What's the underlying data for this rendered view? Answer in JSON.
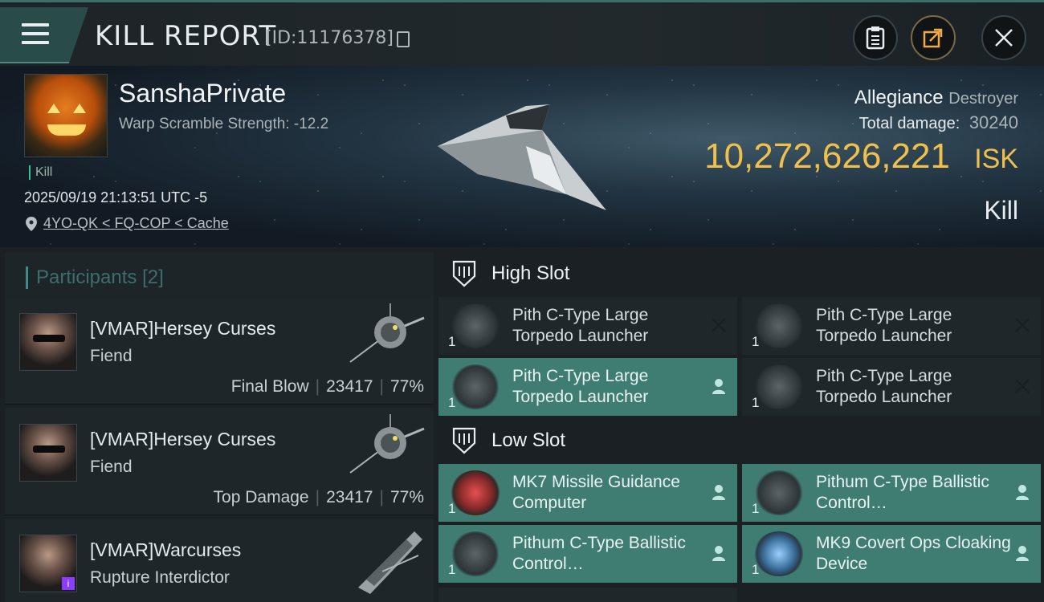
{
  "header": {
    "title": "KILL REPORT",
    "report_id": "[ID:11176378]"
  },
  "victim": {
    "name": "SanshaPrivate",
    "warp_scramble": "Warp Scramble Strength: -12.2",
    "kill_tag": "Kill",
    "datetime": "2025/09/19 21:13:51 UTC -5",
    "location": "4YO-QK < FQ-COP < Cache",
    "allegiance_label": "Allegiance",
    "ship_class": "Destroyer",
    "total_damage_label": "Total damage:",
    "total_damage": "30240",
    "isk_value": "10,272,626,221",
    "isk_unit": "ISK",
    "result": "Kill"
  },
  "participants": {
    "title": "Participants",
    "count": "[2]",
    "rows": [
      {
        "name": "[VMAR]Hersey Curses",
        "ship": "Fiend",
        "role": "Final Blow",
        "damage": "23417",
        "percent": "77%"
      },
      {
        "name": "[VMAR]Hersey Curses",
        "ship": "Fiend",
        "role": "Top Damage",
        "damage": "23417",
        "percent": "77%"
      },
      {
        "name": "[VMAR]Warcurses",
        "ship": "Rupture Interdictor"
      }
    ]
  },
  "slots": {
    "high": {
      "label": "High Slot",
      "modules": [
        {
          "name": "Pith C-Type Large Torpedo Launcher",
          "qty": "1",
          "state": "destroyed"
        },
        {
          "name": "Pith C-Type Large Torpedo Launcher",
          "qty": "1",
          "state": "destroyed"
        },
        {
          "name": "Pith C-Type Large Torpedo Launcher",
          "qty": "1",
          "state": "dropped"
        },
        {
          "name": "Pith C-Type Large Torpedo Launcher",
          "qty": "1",
          "state": "destroyed"
        }
      ]
    },
    "low": {
      "label": "Low Slot",
      "modules": [
        {
          "name": "MK7 Missile Guidance Computer",
          "qty": "1",
          "state": "dropped"
        },
        {
          "name": "Pithum C-Type Ballistic Control…",
          "qty": "1",
          "state": "dropped"
        },
        {
          "name": "Pithum C-Type Ballistic Control…",
          "qty": "1",
          "state": "dropped"
        },
        {
          "name": "MK9 Covert Ops Cloaking Device",
          "qty": "1",
          "state": "dropped"
        }
      ]
    }
  },
  "colors": {
    "accent_teal": "#3f7d73",
    "isk_gold": "#f0c04e",
    "panel": "#20272b"
  }
}
